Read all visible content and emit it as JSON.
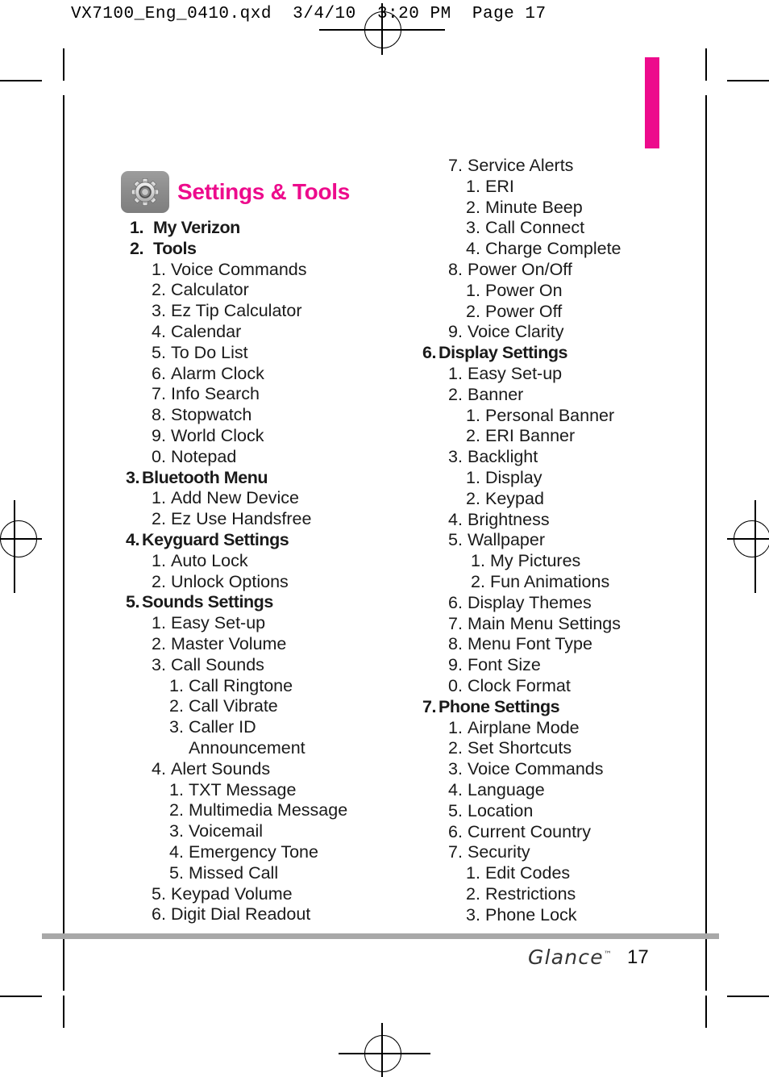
{
  "print_header": "VX7100_Eng_0410.qxd  3/4/10  3:20 PM  Page 17",
  "title": {
    "icon": "gear-icon",
    "text": "Settings & Tools",
    "color": "#ED0B8C",
    "icon_bg": "#8d8d8d"
  },
  "colors": {
    "accent_pink": "#ED0B8C",
    "footer_rule": "#A8A8A8",
    "text": "#1A1A1A"
  },
  "menu": {
    "left_column": [
      {
        "level": 1,
        "num": "1.",
        "label": "My Verizon",
        "wide": true
      },
      {
        "level": 1,
        "num": "2.",
        "label": "Tools",
        "wide": true
      },
      {
        "level": 2,
        "num": "1.",
        "label": "Voice Commands"
      },
      {
        "level": 2,
        "num": "2.",
        "label": "Calculator"
      },
      {
        "level": 2,
        "num": "3.",
        "label": "Ez Tip Calculator"
      },
      {
        "level": 2,
        "num": "4.",
        "label": "Calendar"
      },
      {
        "level": 2,
        "num": "5.",
        "label": "To Do List"
      },
      {
        "level": 2,
        "num": "6.",
        "label": "Alarm Clock"
      },
      {
        "level": 2,
        "num": "7.",
        "label": "Info Search"
      },
      {
        "level": 2,
        "num": "8.",
        "label": "Stopwatch"
      },
      {
        "level": 2,
        "num": "9.",
        "label": "World Clock"
      },
      {
        "level": 2,
        "num": "0.",
        "label": "Notepad"
      },
      {
        "level": 1,
        "num": "3.",
        "label": "Bluetooth Menu"
      },
      {
        "level": 2,
        "num": "1.",
        "label": "Add New Device"
      },
      {
        "level": 2,
        "num": "2.",
        "label": "Ez Use Handsfree"
      },
      {
        "level": 1,
        "num": "4.",
        "label": "Keyguard Settings"
      },
      {
        "level": 2,
        "num": "1.",
        "label": "Auto Lock"
      },
      {
        "level": 2,
        "num": "2.",
        "label": "Unlock Options"
      },
      {
        "level": 1,
        "num": "5.",
        "label": "Sounds Settings"
      },
      {
        "level": 2,
        "num": "1.",
        "label": "Easy Set-up"
      },
      {
        "level": 2,
        "num": "2.",
        "label": "Master Volume"
      },
      {
        "level": 2,
        "num": "3.",
        "label": "Call Sounds"
      },
      {
        "level": 3,
        "num": "1.",
        "label": "Call Ringtone"
      },
      {
        "level": 3,
        "num": "2.",
        "label": "Call Vibrate"
      },
      {
        "level": 3,
        "num": "3.",
        "label": "Caller ID"
      },
      {
        "level": 0,
        "num": "",
        "label": "Announcement"
      },
      {
        "level": 2,
        "num": "4.",
        "label": "Alert Sounds"
      },
      {
        "level": 3,
        "num": "1.",
        "label": "TXT Message"
      },
      {
        "level": 3,
        "num": "2.",
        "label": "Multimedia Message"
      },
      {
        "level": 3,
        "num": "3.",
        "label": "Voicemail"
      },
      {
        "level": 3,
        "num": "4.",
        "label": "Emergency Tone"
      },
      {
        "level": 3,
        "num": "5.",
        "label": "Missed Call"
      },
      {
        "level": 2,
        "num": "5.",
        "label": "Keypad Volume"
      },
      {
        "level": 2,
        "num": "6.",
        "label": "Digit Dial Readout"
      }
    ],
    "right_column": [
      {
        "level": 2,
        "num": "7.",
        "label": "Service Alerts"
      },
      {
        "level": 3,
        "num": "1.",
        "label": "ERI"
      },
      {
        "level": 3,
        "num": "2.",
        "label": "Minute Beep"
      },
      {
        "level": 3,
        "num": "3.",
        "label": "Call Connect"
      },
      {
        "level": 3,
        "num": "4.",
        "label": "Charge Complete"
      },
      {
        "level": 2,
        "num": "8.",
        "label": "Power On/Off"
      },
      {
        "level": 3,
        "num": "1.",
        "label": "Power On"
      },
      {
        "level": 3,
        "num": "2.",
        "label": "Power Off"
      },
      {
        "level": 2,
        "num": "9.",
        "label": "Voice Clarity"
      },
      {
        "level": 1,
        "num": "6.",
        "label": "Display Settings"
      },
      {
        "level": 2,
        "num": "1.",
        "label": "Easy Set-up"
      },
      {
        "level": 2,
        "num": "2.",
        "label": "Banner"
      },
      {
        "level": 3,
        "num": "1.",
        "label": "Personal Banner"
      },
      {
        "level": 3,
        "num": "2.",
        "label": "ERI Banner"
      },
      {
        "level": 2,
        "num": "3.",
        "label": "Backlight"
      },
      {
        "level": 3,
        "num": "1.",
        "label": "Display"
      },
      {
        "level": 3,
        "num": "2.",
        "label": "Keypad"
      },
      {
        "level": 2,
        "num": "4.",
        "label": "Brightness"
      },
      {
        "level": 2,
        "num": "5.",
        "label": "Wallpaper"
      },
      {
        "level": 3,
        "num": "1.",
        "label": "My Pictures",
        "deep": true
      },
      {
        "level": 3,
        "num": "2.",
        "label": "Fun Animations",
        "deep": true
      },
      {
        "level": 2,
        "num": "6.",
        "label": "Display Themes"
      },
      {
        "level": 2,
        "num": "7.",
        "label": "Main Menu Settings"
      },
      {
        "level": 2,
        "num": "8.",
        "label": "Menu Font Type"
      },
      {
        "level": 2,
        "num": "9.",
        "label": "Font Size"
      },
      {
        "level": 2,
        "num": "0.",
        "label": "Clock Format"
      },
      {
        "level": 1,
        "num": "7.",
        "label": "Phone Settings"
      },
      {
        "level": 2,
        "num": "1.",
        "label": "Airplane Mode"
      },
      {
        "level": 2,
        "num": "2.",
        "label": "Set Shortcuts"
      },
      {
        "level": 2,
        "num": "3.",
        "label": "Voice Commands"
      },
      {
        "level": 2,
        "num": "4.",
        "label": "Language"
      },
      {
        "level": 2,
        "num": "5.",
        "label": "Location"
      },
      {
        "level": 2,
        "num": "6.",
        "label": "Current Country"
      },
      {
        "level": 2,
        "num": "7.",
        "label": "Security"
      },
      {
        "level": 3,
        "num": "1.",
        "label": "Edit Codes"
      },
      {
        "level": 3,
        "num": "2.",
        "label": "Restrictions"
      },
      {
        "level": 3,
        "num": "3.",
        "label": "Phone Lock"
      }
    ]
  },
  "footer": {
    "brand": "Glance",
    "trademark": "™",
    "page_number": "17"
  }
}
